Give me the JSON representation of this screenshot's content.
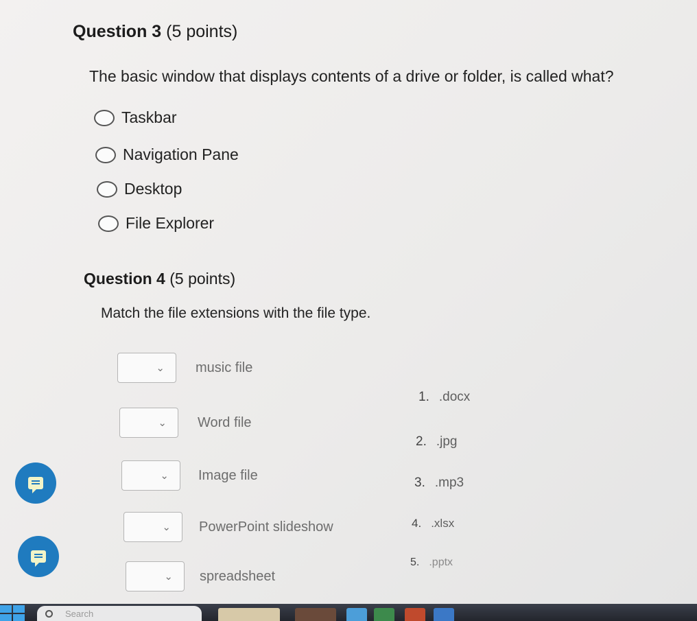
{
  "question3": {
    "title": "Question 3",
    "points": "(5 points)",
    "text": "The basic window that displays contents of a drive or folder, is called what?",
    "options": [
      "Taskbar",
      "Navigation Pane",
      "Desktop",
      "File Explorer"
    ]
  },
  "question4": {
    "title": "Question 4",
    "points": "(5 points)",
    "text": "Match the file extensions with the file type.",
    "items": [
      "music file",
      "Word file",
      "Image file",
      "PowerPoint slideshow",
      "spreadsheet"
    ],
    "answers": [
      {
        "num": "1.",
        "ext": ".docx"
      },
      {
        "num": "2.",
        "ext": ".jpg"
      },
      {
        "num": "3.",
        "ext": ".mp3"
      },
      {
        "num": "4.",
        "ext": ".xlsx"
      },
      {
        "num": "5.",
        "ext": ".pptx"
      }
    ]
  },
  "taskbar": {
    "search_placeholder": "Search"
  },
  "icons": {
    "dropdown": "chevron-down-icon",
    "chat": "chat-bubble-icon",
    "start": "windows-logo-icon",
    "search": "search-icon"
  },
  "colors": {
    "chat_button": "#1f7bbf",
    "start_logo": "#3fa3e8",
    "taskbar": "#23262d"
  }
}
